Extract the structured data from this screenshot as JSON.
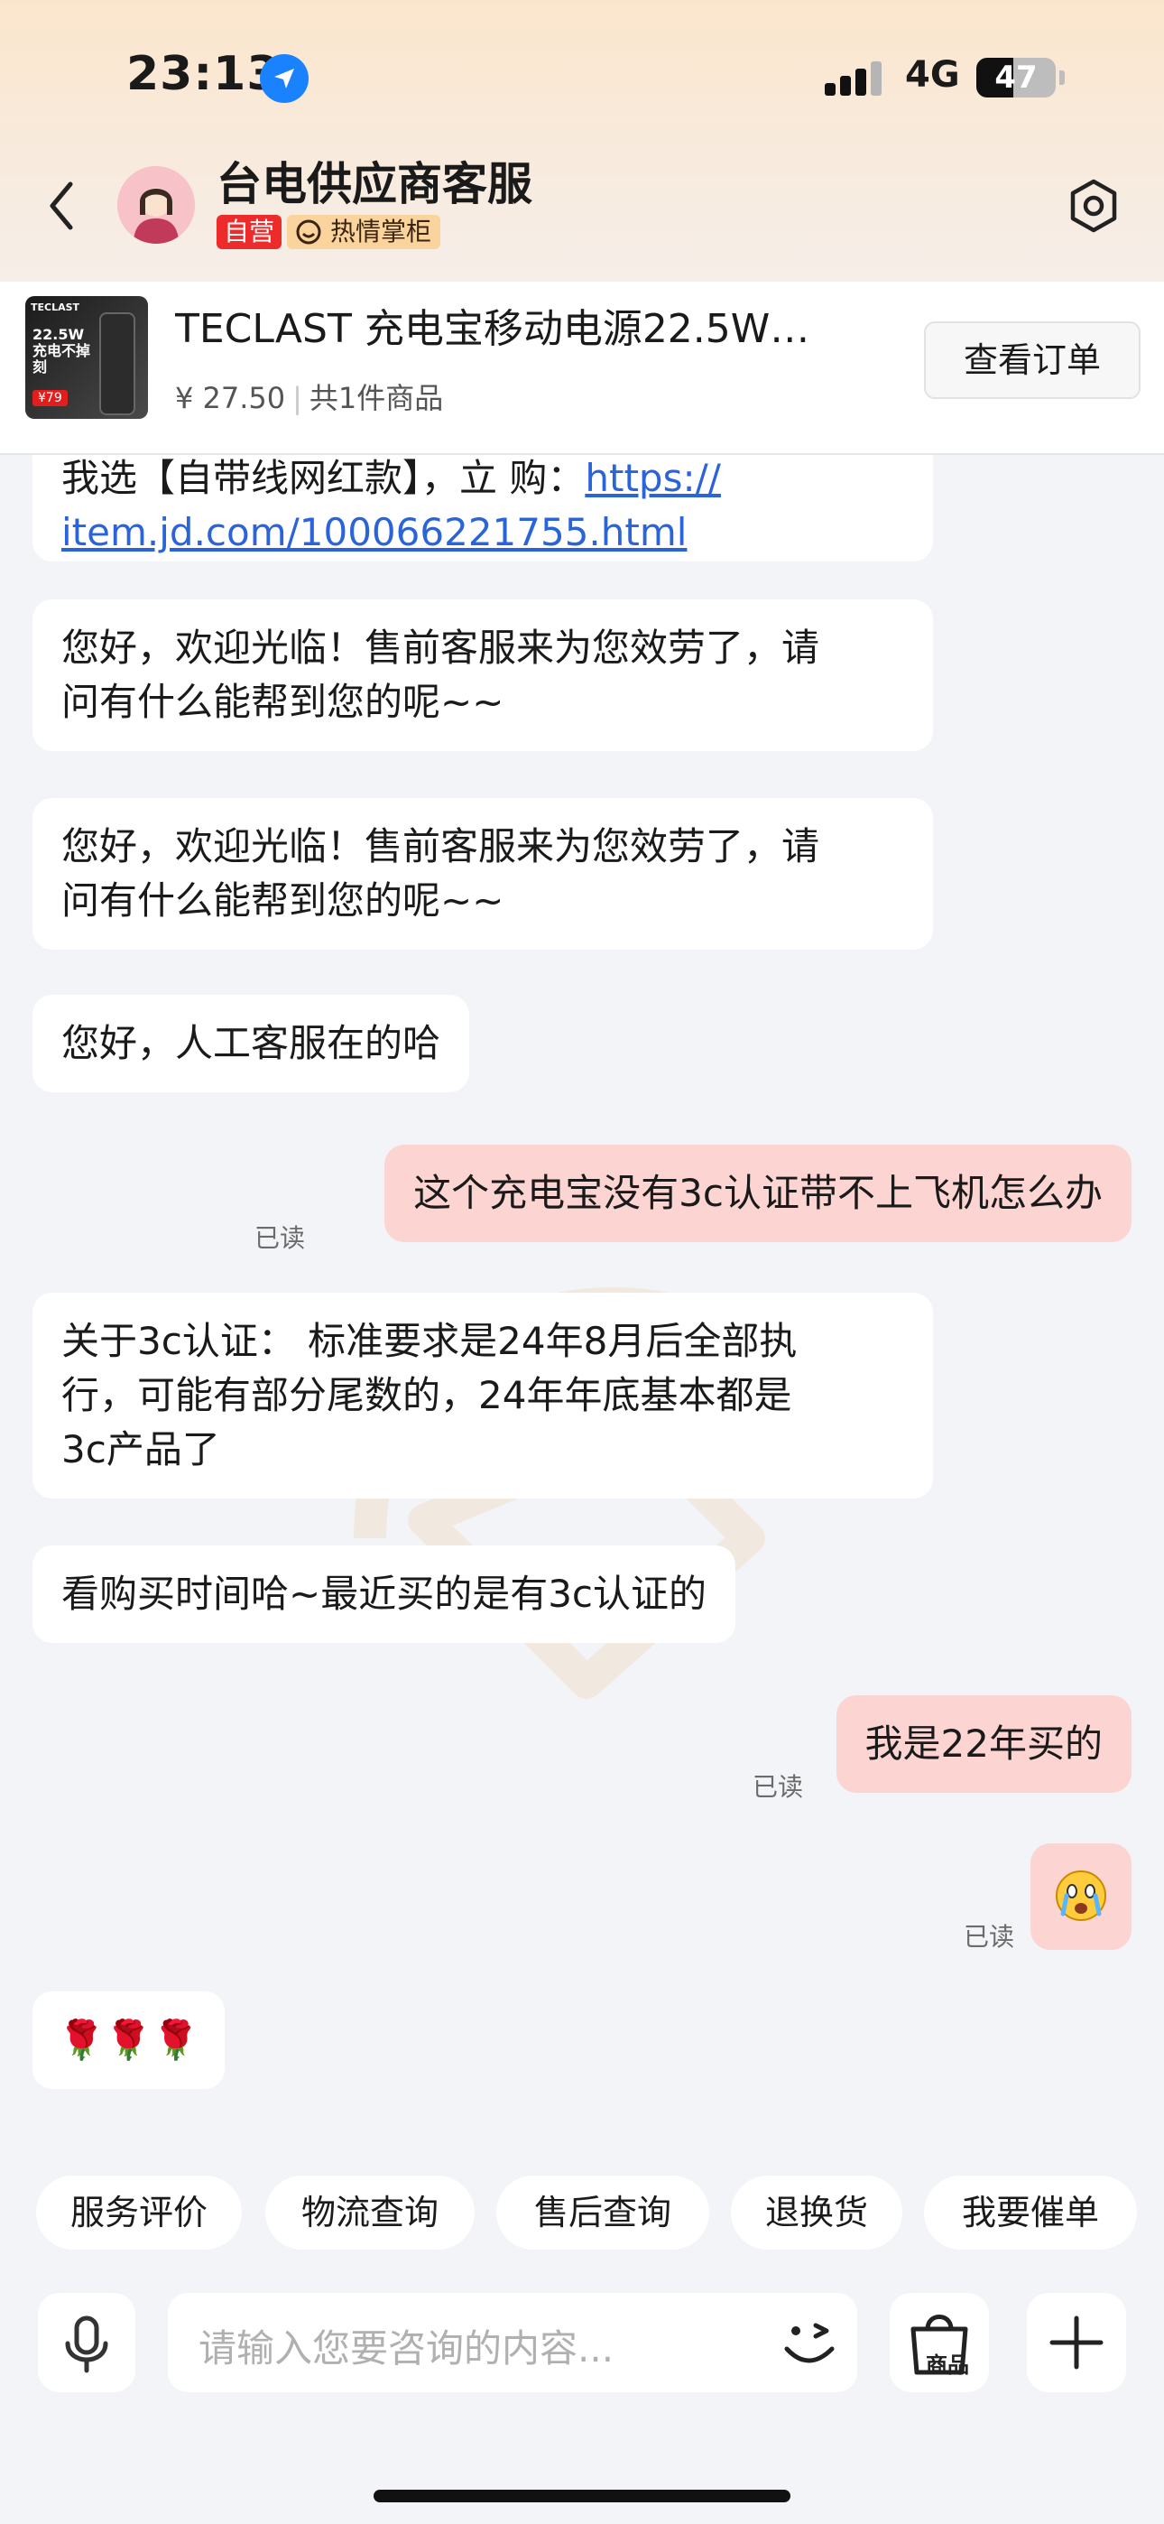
{
  "status_bar": {
    "time": "23:13",
    "network": "4G",
    "battery": "47",
    "battery_level": 0.47
  },
  "header": {
    "title": "台电供应商客服",
    "badge_self": "自营",
    "badge_hot": "热情掌柜"
  },
  "product": {
    "name": "TECLAST 充电宝移动电源22.5W…",
    "price": "¥ 27.50",
    "count": "共1件商品",
    "order_button": "查看订单",
    "image_brand": "TECLAST",
    "image_text": "22.5W 充电不掉刻",
    "image_price": "¥79"
  },
  "messages": {
    "m0_top": "我选【自带线网红款】，立  购：",
    "m0_link_a": "https://",
    "m0_link_b": "item.jd.com/100066221755.html",
    "m1_line1": "您好，欢迎光临！售前客服来为您效劳了，请",
    "m1_line2": "问有什么能帮到您的呢~~",
    "m2_line1": "您好，欢迎光临！售前客服来为您效劳了，请",
    "m2_line2": "问有什么能帮到您的呢~~",
    "m3": "您好，人工客服在的哈",
    "m4": "这个充电宝没有3c认证带不上飞机怎么办",
    "m4_read": "已读",
    "m5_line1": "关于3c认证： 标准要求是24年8月后全部执",
    "m5_line2": "行，可能有部分尾数的，24年年底基本都是",
    "m5_line3": "3c产品了",
    "m6": "看购买时间哈~最近买的是有3c认证的",
    "m7": "我是22年买的",
    "m7_read": "已读",
    "m8_read": "已读",
    "m9": "🌹🌹🌹"
  },
  "quick_replies": [
    "服务评价",
    "物流查询",
    "售后查询",
    "退换货",
    "我要催单"
  ],
  "input": {
    "placeholder": "请输入您要咨询的内容...",
    "goods_label": "商品"
  }
}
